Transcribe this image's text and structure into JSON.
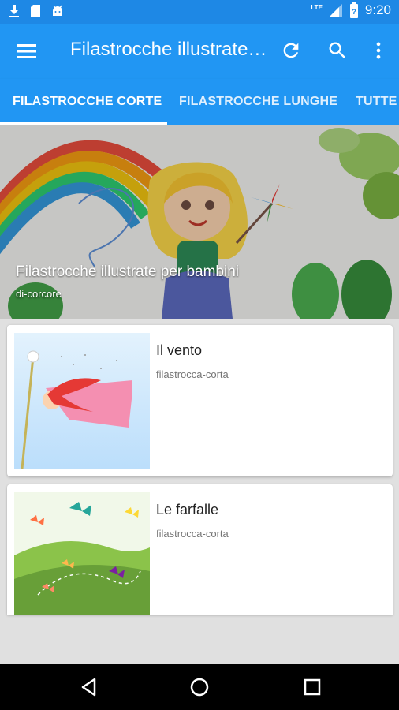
{
  "status_bar": {
    "time": "9:20",
    "network": "LTE",
    "icons": [
      "download-icon",
      "sd-card-icon",
      "android-icon",
      "signal-icon",
      "battery-icon"
    ]
  },
  "app_bar": {
    "title": "Filastrocche illustrate per bambini",
    "icons": [
      "menu-icon",
      "refresh-icon",
      "search-icon",
      "more-vert-icon"
    ]
  },
  "tabs": [
    {
      "label": "FILASTROCCHE CORTE",
      "selected": true
    },
    {
      "label": "FILASTROCCHE LUNGHE",
      "selected": false
    },
    {
      "label": "TUTTE",
      "selected": false
    }
  ],
  "hero": {
    "title": "Filastrocche illustrate per bambini",
    "author": "di-corcore"
  },
  "cards": [
    {
      "title": "Il vento",
      "category": "filastrocca-corta"
    },
    {
      "title": "Le farfalle",
      "category": "filastrocca-corta"
    }
  ],
  "colors": {
    "status_bar": "#1e88e5",
    "primary": "#2196f3",
    "background": "#e0e0e0"
  }
}
